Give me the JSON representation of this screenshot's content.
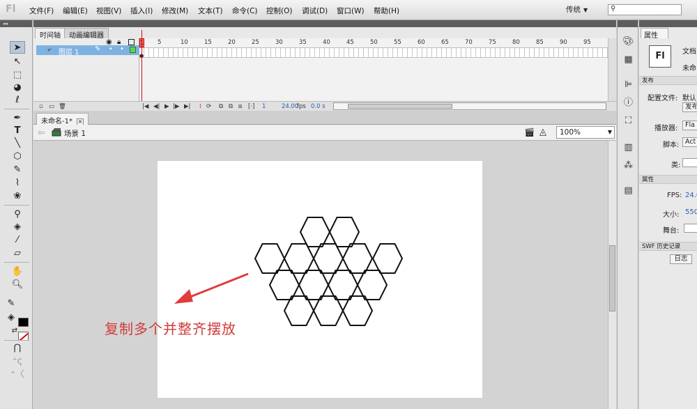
{
  "app": {
    "logo": "Fl"
  },
  "menu": [
    "文件(F)",
    "编辑(E)",
    "视图(V)",
    "插入(I)",
    "修改(M)",
    "文本(T)",
    "命令(C)",
    "控制(O)",
    "调试(D)",
    "窗口(W)",
    "帮助(H)"
  ],
  "workspace": {
    "label": "传统",
    "arrow": "▼"
  },
  "search": {
    "placeholder": "",
    "glyph": "⚲"
  },
  "timeline": {
    "tabs": [
      "时间轴",
      "动画编辑器"
    ],
    "frame_numbers": [
      "1",
      "5",
      "10",
      "15",
      "20",
      "25",
      "30",
      "35",
      "40",
      "45",
      "50",
      "55",
      "60",
      "65",
      "70",
      "75",
      "80",
      "85",
      "90",
      "95"
    ],
    "layer_name": "图层 1",
    "current_frame": "1",
    "fps_value": "24.00",
    "fps_unit": "fps",
    "elapsed": "0.0 s"
  },
  "document": {
    "tab_name": "未命名-1*",
    "close_glyph": "×",
    "scene_label": "场景 1",
    "zoom": "100%"
  },
  "stage": {
    "annotation": "复制多个并整齐摆放",
    "arrow_color": "#e03c3c",
    "hexagon_count": 14
  },
  "properties": {
    "tab": "属性",
    "doc_type": "文档",
    "doc_name": "未命",
    "section_publish": "发布",
    "profile_label": "配置文件:",
    "profile_value": "默认",
    "publish_button": "发布",
    "player_label": "播放器:",
    "player_value": "Fla",
    "script_label": "脚本:",
    "script_value": "Act",
    "class_label": "类:",
    "section_props": "属性",
    "fps_label": "FPS:",
    "fps_value": "24.0",
    "size_label": "大小:",
    "size_value": "550",
    "stage_label": "舞台:",
    "section_history": "SWF 历史记录",
    "log_button": "日志"
  }
}
